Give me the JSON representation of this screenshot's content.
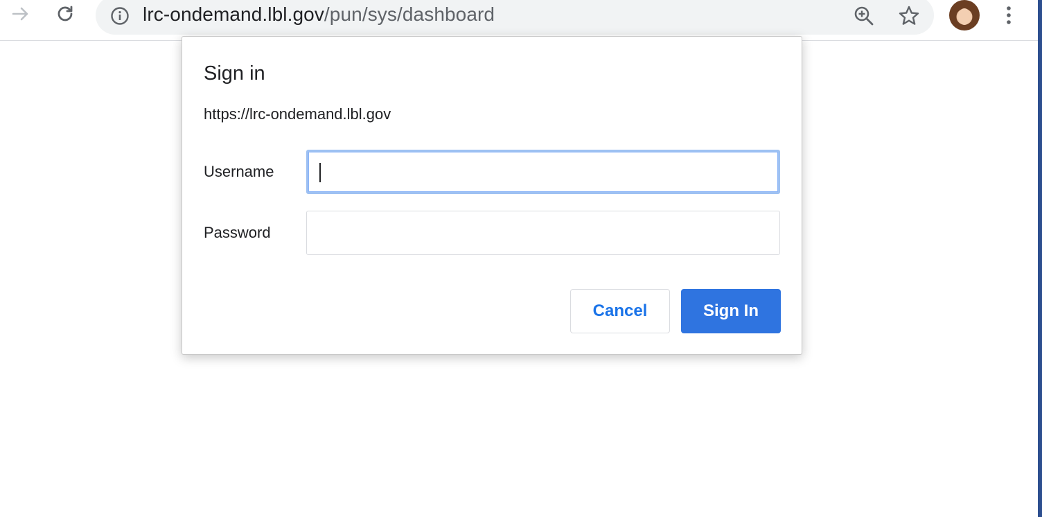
{
  "browser": {
    "url_host": "lrc-ondemand.lbl.gov",
    "url_path": "/pun/sys/dashboard",
    "icons": {
      "forward": "forward-arrow-icon",
      "reload": "reload-icon",
      "info": "info-icon",
      "zoom": "zoom-in-icon",
      "bookmark": "star-icon",
      "menu": "kebab-menu-icon"
    }
  },
  "dialog": {
    "title": "Sign in",
    "origin": "https://lrc-ondemand.lbl.gov",
    "username_label": "Username",
    "username_value": "",
    "password_label": "Password",
    "password_value": "",
    "cancel_label": "Cancel",
    "signin_label": "Sign In"
  },
  "colors": {
    "accent": "#1a73e8",
    "primary_button": "#2f74e0",
    "focus_ring": "#9ec1f2"
  }
}
